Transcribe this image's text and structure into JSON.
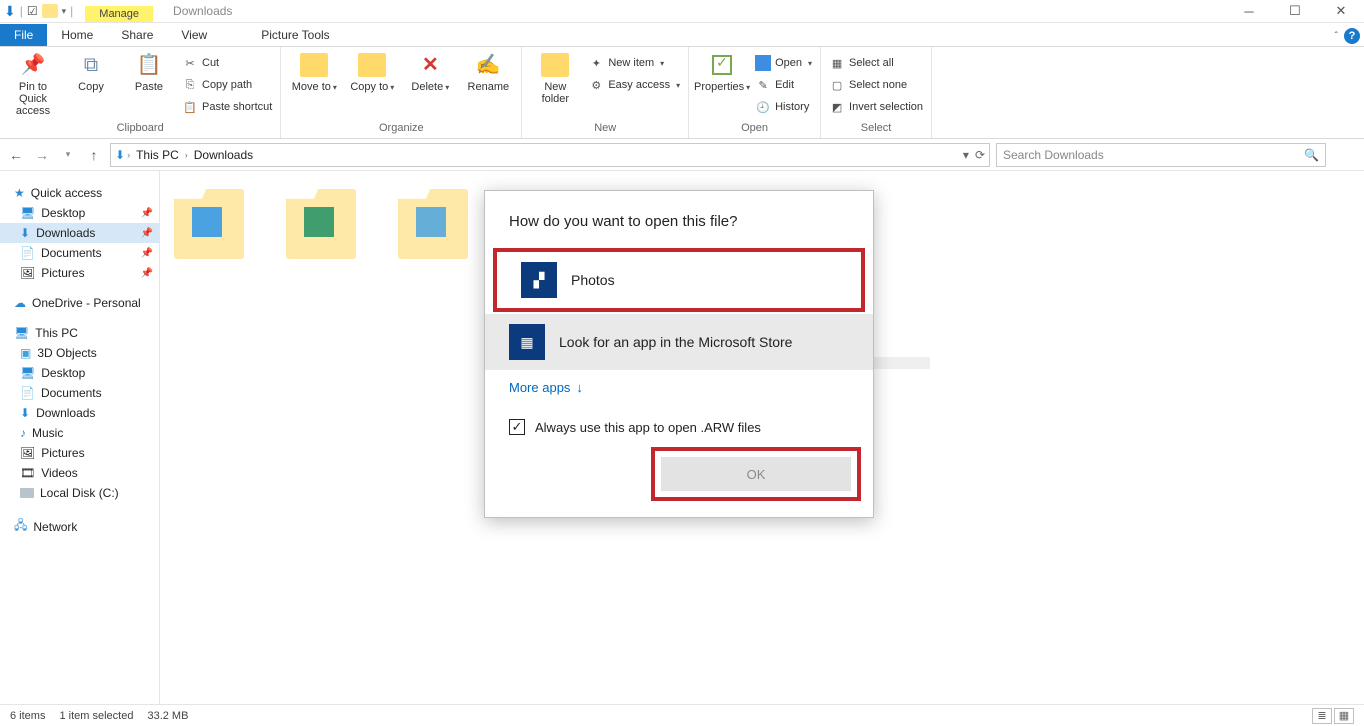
{
  "window": {
    "title": "Downloads",
    "contextual_tab": "Manage",
    "picture_tools": "Picture Tools"
  },
  "tabs": {
    "file": "File",
    "home": "Home",
    "share": "Share",
    "view": "View",
    "picture": "Picture Tools"
  },
  "ribbon": {
    "clipboard": {
      "label": "Clipboard",
      "pin": "Pin to Quick access",
      "copy": "Copy",
      "paste": "Paste",
      "cut": "Cut",
      "copy_path": "Copy path",
      "paste_shortcut": "Paste shortcut"
    },
    "organize": {
      "label": "Organize",
      "move_to": "Move to",
      "copy_to": "Copy to",
      "delete": "Delete",
      "rename": "Rename"
    },
    "new": {
      "label": "New",
      "new_folder": "New folder",
      "new_item": "New item",
      "easy_access": "Easy access"
    },
    "open": {
      "label": "Open",
      "properties": "Properties",
      "open": "Open",
      "edit": "Edit",
      "history": "History"
    },
    "select": {
      "label": "Select",
      "select_all": "Select all",
      "select_none": "Select none",
      "invert": "Invert selection"
    }
  },
  "breadcrumb": {
    "root": "This PC",
    "folder": "Downloads"
  },
  "search": {
    "placeholder": "Search Downloads"
  },
  "sidebar": {
    "quick_access": "Quick access",
    "desktop": "Desktop",
    "downloads": "Downloads",
    "documents": "Documents",
    "pictures": "Pictures",
    "onedrive": "OneDrive - Personal",
    "this_pc": "This PC",
    "objects3d": "3D Objects",
    "music": "Music",
    "videos": "Videos",
    "local_disk": "Local Disk (C:)",
    "network": "Network"
  },
  "dialog": {
    "title": "How do you want to open this file?",
    "photos": "Photos",
    "store": "Look for an app in the Microsoft Store",
    "more": "More apps",
    "always": "Always use this app to open .ARW files",
    "ok": "OK"
  },
  "status": {
    "items": "6 items",
    "selected": "1 item selected",
    "size": "33.2 MB"
  }
}
